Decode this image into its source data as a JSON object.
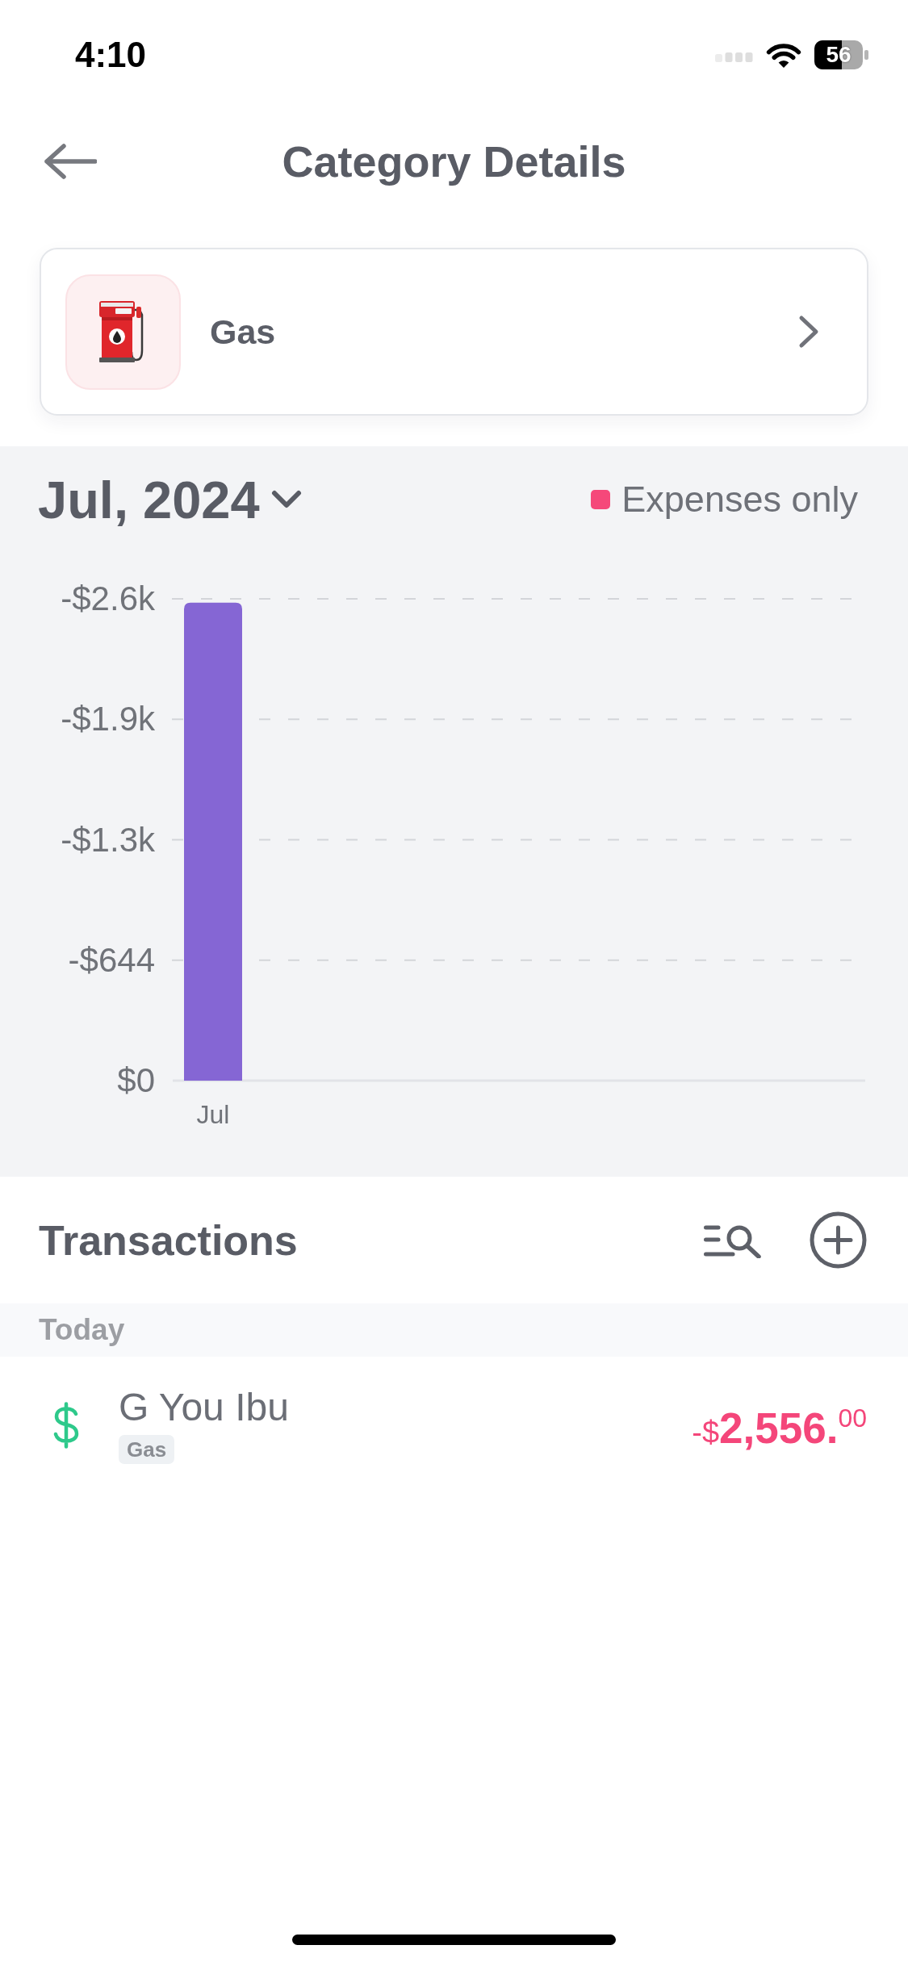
{
  "status_bar": {
    "time": "4:10",
    "battery": "56"
  },
  "header": {
    "title": "Category Details"
  },
  "category": {
    "name": "Gas"
  },
  "chart": {
    "period": "Jul, 2024",
    "legend": [
      {
        "label": "Expenses only",
        "color": "#f5487a"
      }
    ],
    "chart_data": {
      "type": "bar",
      "categories": [
        "Jul"
      ],
      "series": [
        {
          "color": "#8566d4",
          "values": [
            -2556
          ]
        }
      ],
      "ylim": [
        0,
        -2576
      ],
      "yticks": [
        {
          "value": 0,
          "label": "$0"
        },
        {
          "value": -644,
          "label": "-$644"
        },
        {
          "value": -1288,
          "label": "-$1.3k"
        },
        {
          "value": -1932,
          "label": "-$1.9k"
        },
        {
          "value": -2576,
          "label": "-$2.6k"
        }
      ],
      "grid": true
    }
  },
  "transactions": {
    "title": "Transactions",
    "groups": [
      {
        "label": "Today",
        "items": [
          {
            "payee": "G You Ibu",
            "category": "Gas",
            "amount": {
              "sign": "-$",
              "whole": "2,556.",
              "cents": "00"
            }
          }
        ]
      }
    ]
  }
}
